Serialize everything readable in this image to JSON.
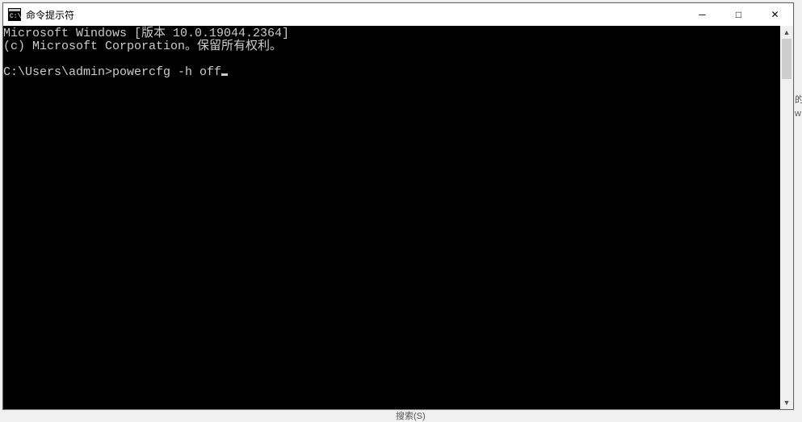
{
  "window": {
    "title": "命令提示符",
    "icon_name": "cmd-icon"
  },
  "titlebar_buttons": {
    "minimize": "─",
    "maximize": "□",
    "close": "✕"
  },
  "terminal": {
    "line1": "Microsoft Windows [版本 10.0.19044.2364]",
    "line2": "(c) Microsoft Corporation。保留所有权利。",
    "blank": "",
    "prompt": "C:\\Users\\admin>",
    "command": "powercfg -h off"
  },
  "scrollbar": {
    "up": "▲",
    "down": "▼"
  },
  "background": {
    "frag1": "搜索(S)",
    "frag2": "的",
    "frag3": "w"
  }
}
